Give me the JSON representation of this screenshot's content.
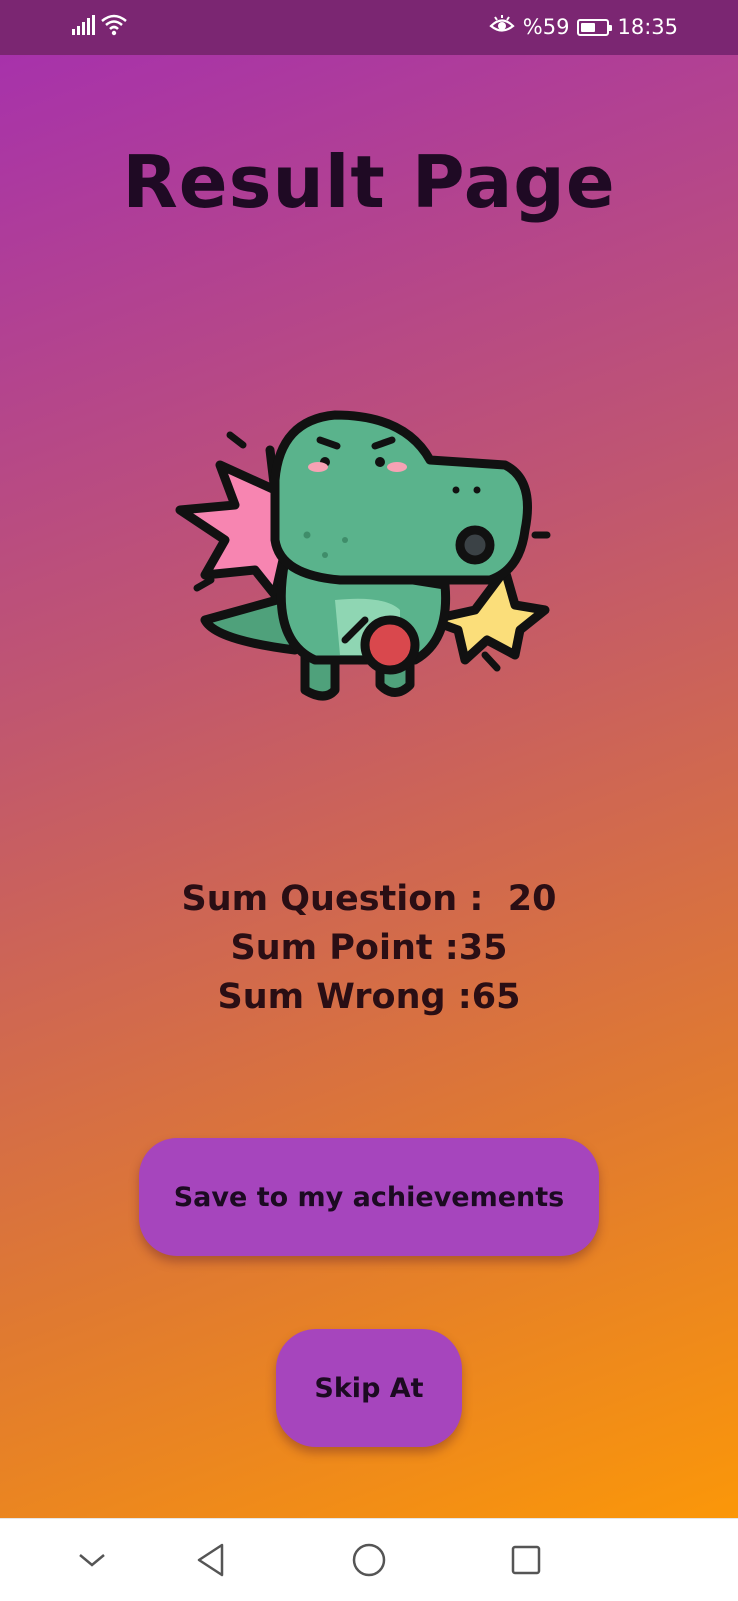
{
  "status_bar": {
    "battery_text": "%59",
    "battery_level": 0.59,
    "time": "18:35",
    "icons": [
      "signal-icon",
      "wifi-icon",
      "eye-comfort-icon",
      "battery-icon"
    ]
  },
  "page": {
    "title": "Result Page",
    "illustration": "dinosaur-mascot",
    "colors": {
      "gradient_start": "#a52fb0",
      "gradient_end": "#fb9709",
      "button": "#a645bd"
    }
  },
  "stats": {
    "question_line": "Sum Question :  20",
    "point_line": "Sum Point :35",
    "wrong_line": "Sum Wrong :65"
  },
  "actions": {
    "save_label": "Save to my achievements",
    "skip_label": "Skip At"
  },
  "nav_bar": {
    "icons": [
      "collapse-chevron-icon",
      "back-icon",
      "home-icon",
      "recents-icon"
    ]
  }
}
